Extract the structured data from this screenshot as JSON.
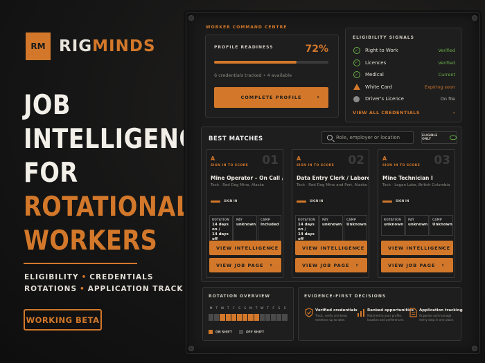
{
  "brand": {
    "mark": "RM",
    "name_part1": "RIG",
    "name_part2": "MINDS"
  },
  "headline": {
    "line1": "JOB",
    "line2": "INTELLIGENCE",
    "line3": "FOR",
    "line4": "ROTATIONAL",
    "line5": "WORKERS"
  },
  "tags": {
    "t1": "ELIGIBILITY",
    "t2": "CREDENTIALS",
    "t3": "ROTATIONS",
    "t4": "APPLICATION TRACKING",
    "sep": "•"
  },
  "beta_label": "WORKING BETA",
  "command_centre": {
    "title": "WORKER COMMAND CENTRE",
    "profile": {
      "label": "PROFILE READINESS",
      "percent_text": "72%",
      "progress_fraction": 0.72,
      "meta": "6 credentials tracked • 4 available",
      "button": "COMPLETE PROFILE",
      "chevron": "›"
    },
    "eligibility": {
      "title": "ELIGIBILITY SIGNALS",
      "rows": [
        {
          "name": "Right to Work",
          "status": "Verified",
          "icon": "check-circle-icon",
          "color": "#6bb04a"
        },
        {
          "name": "Licences",
          "status": "Verified",
          "icon": "check-circle-icon",
          "color": "#6bb04a"
        },
        {
          "name": "Medical",
          "status": "Current",
          "icon": "check-circle-icon",
          "color": "#6bb04a"
        },
        {
          "name": "White Card",
          "status": "Expiring soon",
          "icon": "warning-triangle-icon",
          "color": "#d3782a"
        },
        {
          "name": "Driver's Licence",
          "status": "On file",
          "icon": "grey-dot-icon",
          "color": "#b8b4ae"
        }
      ],
      "view_all": "VIEW ALL CREDENTIALS",
      "chevron": "›"
    }
  },
  "matches": {
    "title": "BEST MATCHES",
    "search_placeholder": "Role, employer or location",
    "eligible_only": "ELIGIBLE ONLY",
    "cards": [
      {
        "grade": "A",
        "sign_in_to_score": "SIGN IN TO SCORE",
        "num": "01",
        "job_title": "Mine Operator – On Call / Casual",
        "company": "Teck · Red Dog Mine, Alaska",
        "sign_in": "SIGN IN",
        "facts": [
          {
            "k": "ROTATION",
            "v1": "14 days on /",
            "v2": "14 days off"
          },
          {
            "k": "PAY",
            "v1": "unknown",
            "v2": ""
          },
          {
            "k": "CAMP",
            "v1": "Included",
            "v2": ""
          }
        ],
        "btn1": "VIEW INTELLIGENCE",
        "btn2": "VIEW JOB PAGE",
        "chevron": "›"
      },
      {
        "grade": "A",
        "sign_in_to_score": "SIGN IN TO SCORE",
        "num": "02",
        "job_title": "Data Entry Clerk / Laborer",
        "company": "Teck · Red Dog Mine and Port, Alaska",
        "sign_in": "SIGN IN",
        "facts": [
          {
            "k": "ROTATION",
            "v1": "14 days on /",
            "v2": "14 days off"
          },
          {
            "k": "PAY",
            "v1": "unknown",
            "v2": ""
          },
          {
            "k": "CAMP",
            "v1": "Unknown",
            "v2": ""
          }
        ],
        "btn1": "VIEW INTELLIGENCE",
        "btn2": "VIEW JOB PAGE",
        "chevron": "›"
      },
      {
        "grade": "A",
        "sign_in_to_score": "SIGN IN TO SCORE",
        "num": "03",
        "job_title": "Mine Technician I",
        "company": "Teck · Logan Lake, British Columbia",
        "sign_in": "SIGN IN",
        "facts": [
          {
            "k": "ROTATION",
            "v1": "unknown",
            "v2": ""
          },
          {
            "k": "PAY",
            "v1": "unknown",
            "v2": ""
          },
          {
            "k": "CAMP",
            "v1": "Unknown",
            "v2": ""
          }
        ],
        "btn1": "VIEW INTELLIGENCE",
        "btn2": "VIEW JOB PAGE",
        "chevron": "›"
      }
    ]
  },
  "rotation": {
    "title": "ROTATION OVERVIEW",
    "days": [
      "M",
      "T",
      "W",
      "T",
      "F",
      "S",
      "S",
      "M",
      "T",
      "W",
      "T",
      "F",
      "S",
      "S"
    ],
    "on_pattern": [
      false,
      false,
      true,
      true,
      true,
      true,
      true,
      true,
      true,
      false,
      false,
      false,
      false,
      false
    ],
    "legend_on": "ON SHIFT",
    "legend_off": "OFF SHIFT"
  },
  "evidence": {
    "title": "EVIDENCE-FIRST DECISIONS",
    "items": [
      {
        "title": "Verified credentials",
        "desc": "Track, verify and keep evidence up to date.",
        "icon": "shield-check-icon"
      },
      {
        "title": "Ranked opportunities",
        "desc": "Matched to your profile, location and preferences.",
        "icon": "bar-chart-icon"
      },
      {
        "title": "Application tracking",
        "desc": "Organise and manage every step in one place.",
        "icon": "document-icon"
      }
    ]
  },
  "colors": {
    "accent": "#d3782a",
    "ok": "#6bb04a",
    "background": "#141414"
  }
}
